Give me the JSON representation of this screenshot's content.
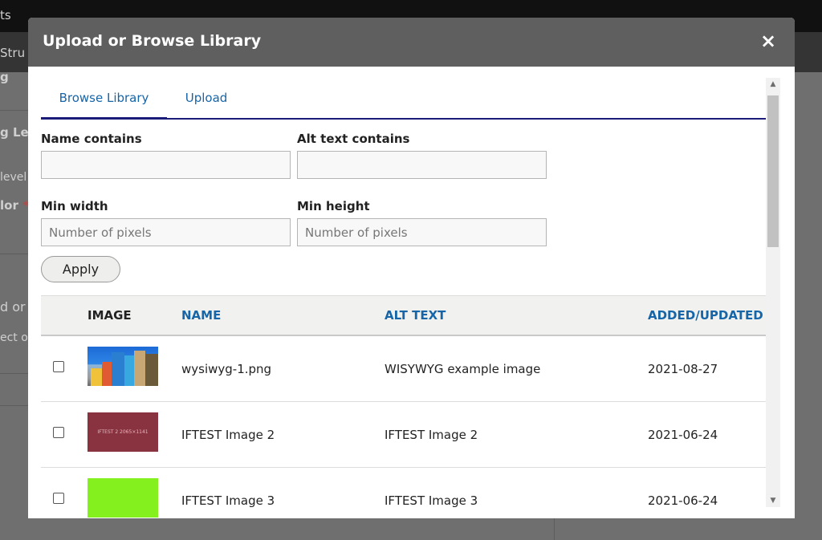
{
  "background": {
    "fragments": [
      "ts",
      "Stru",
      "g",
      "g Lev",
      "level",
      "lor",
      "*",
      "d or",
      "ect or"
    ]
  },
  "dialog": {
    "title": "Upload or Browse Library",
    "close_symbol": "×",
    "tabs": [
      {
        "label": "Browse Library",
        "active": true
      },
      {
        "label": "Upload",
        "active": false
      }
    ],
    "filters": {
      "name_label": "Name contains",
      "name_value": "",
      "alt_label": "Alt text contains",
      "alt_value": "",
      "min_width_label": "Min width",
      "min_width_placeholder": "Number of pixels",
      "min_height_label": "Min height",
      "min_height_placeholder": "Number of pixels",
      "apply_label": "Apply"
    },
    "table": {
      "headers": {
        "image": "IMAGE",
        "name": "NAME",
        "alt": "ALT TEXT",
        "added": "ADDED/UPDATED"
      },
      "rows": [
        {
          "name": "wysiwyg-1.png",
          "alt": "WISYWYG example image",
          "added": "2021-08-27",
          "thumb_color": "#2f86e6"
        },
        {
          "name": "IFTEST Image 2",
          "alt": "IFTEST Image 2",
          "added": "2021-06-24",
          "thumb_color": "#8a3340",
          "thumb_text": "IFTEST 2 2065×1141"
        },
        {
          "name": "IFTEST Image 3",
          "alt": "IFTEST Image 3",
          "added": "2021-06-24",
          "thumb_color": "#84f01e"
        }
      ]
    },
    "icons": {
      "close": "close-icon",
      "scroll_up": "scroll-up-arrow-icon",
      "scroll_down": "scroll-down-arrow-icon"
    }
  }
}
